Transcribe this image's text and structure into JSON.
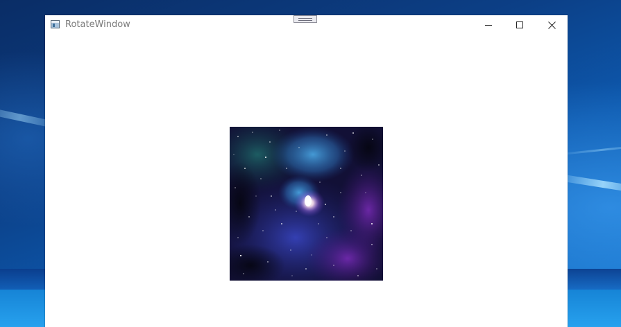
{
  "window": {
    "title": "RotateWindow",
    "icon": "app-window-icon",
    "controls": {
      "minimize_icon": "minimize-icon",
      "maximize_icon": "maximize-icon",
      "close_icon": "close-icon"
    },
    "drag_handle_icon": "drag-grip-icon"
  },
  "content": {
    "image": {
      "subject": "space-nebula-image"
    }
  },
  "colors": {
    "desktop_dark": "#0a2d66",
    "desktop_light": "#1677cf",
    "window_bg": "#ffffff",
    "title_text": "#7a7a7a"
  }
}
